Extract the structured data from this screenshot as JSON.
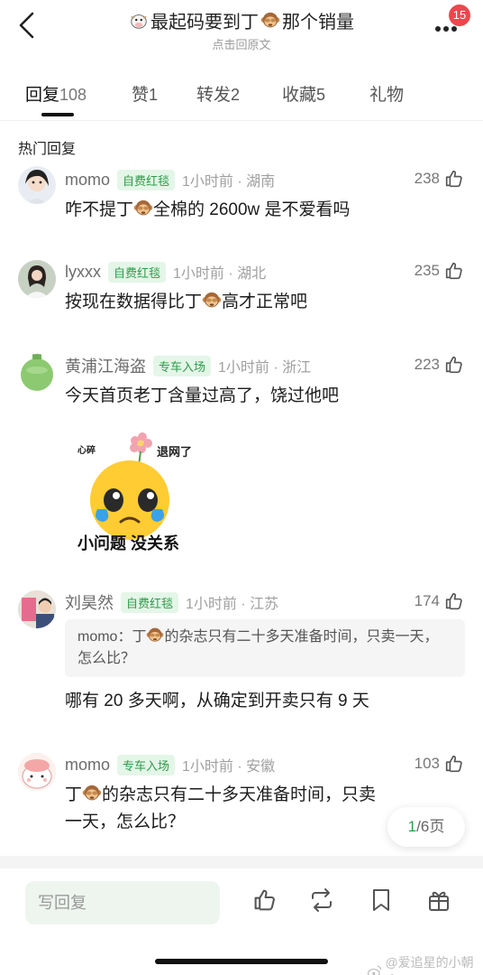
{
  "header": {
    "title_before": "最起码要到丁",
    "title_after": "那个销量",
    "subtitle": "点击回原文",
    "notification_count": "15"
  },
  "tabs": [
    {
      "label": "回复",
      "count": "108",
      "active": true
    },
    {
      "label": "赞",
      "count": "1"
    },
    {
      "label": "转发",
      "count": "2"
    },
    {
      "label": "收藏",
      "count": "5"
    },
    {
      "label": "礼物",
      "count": ""
    }
  ],
  "section_title": "热门回复",
  "comments": [
    {
      "name": "momo",
      "tag": "自费红毯",
      "time": "1小时前 · 湖南",
      "likes": "238",
      "text_before": "咋不提丁",
      "text_after": "全棉的 2600w 是不爱看吗"
    },
    {
      "name": "lyxxx",
      "tag": "自费红毯",
      "time": "1小时前 · 湖北",
      "likes": "235",
      "text_before": "按现在数据得比丁",
      "text_after": "高才正常吧"
    },
    {
      "name": "黄浦江海盗",
      "tag": "专车入场",
      "time": "1小时前 · 浙江",
      "likes": "223",
      "text": "今天首页老丁含量过高了，饶过他吧",
      "sticker": {
        "top_left": "心碎",
        "top_right": "退网了",
        "caption": "小问题 没关系"
      }
    },
    {
      "name": "刘昊然",
      "tag": "自费红毯",
      "time": "1小时前 · 江苏",
      "likes": "174",
      "quote_before": "momo：丁",
      "quote_after": "的杂志只有二十多天准备时间，只卖一天，怎么比？",
      "text": "哪有 20 多天啊，从确定到开卖只有 9 天"
    },
    {
      "name": "momo",
      "tag": "专车入场",
      "time": "1小时前 · 安徽",
      "likes": "103",
      "text_before": "丁",
      "text_after": "的杂志只有二十多天准备时间，只卖一天，怎么比？"
    }
  ],
  "pager": {
    "current": "1",
    "total": "/6页"
  },
  "bottom": {
    "reply_placeholder": "写回复"
  },
  "watermark": "@爱追星的小朝迎",
  "colors": {
    "accent_green": "#2e9b4a",
    "tag_bg": "#e4f6e8",
    "badge_red": "#f0454d"
  }
}
